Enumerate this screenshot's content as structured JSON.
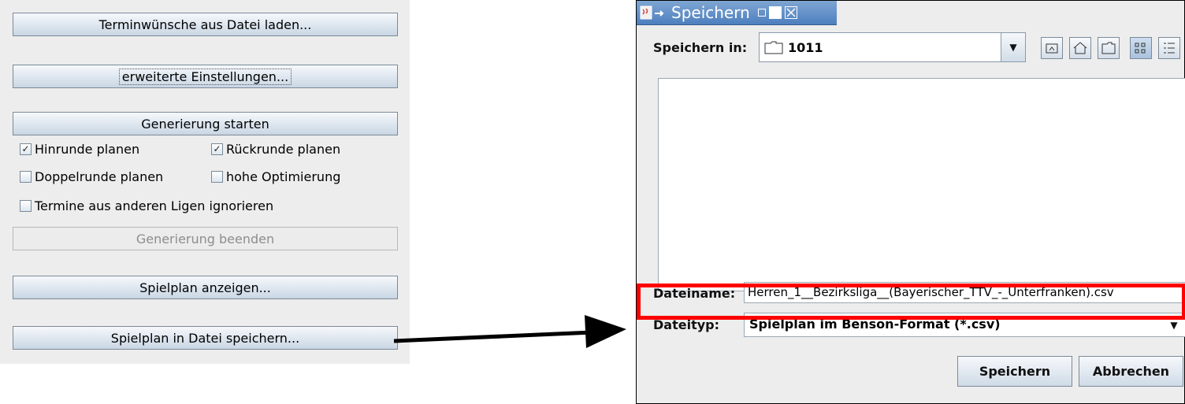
{
  "left": {
    "buttons": {
      "load": "Terminwünsche aus Datei laden...",
      "advanced": "erweiterte Einstellungen...",
      "start": "Generierung starten",
      "stop": "Generierung beenden",
      "show": "Spielplan anzeigen...",
      "save": "Spielplan in Datei speichern..."
    },
    "checkboxes": {
      "hinrunde": {
        "label": "Hinrunde planen",
        "checked": true
      },
      "rueckrunde": {
        "label": "Rückrunde planen",
        "checked": true
      },
      "doppelrunde": {
        "label": "Doppelrunde planen",
        "checked": false
      },
      "optimierung": {
        "label": "hohe Optimierung",
        "checked": false
      },
      "ignorieren": {
        "label": "Termine aus anderen Ligen ignorieren",
        "checked": false
      }
    }
  },
  "dialog": {
    "title": "Speichern",
    "save_in_label": "Speichern in:",
    "folder": "1011",
    "filename_label": "Dateiname:",
    "filename": "Herren_1__Bezirksliga__(Bayerischer_TTV_-_Unterfranken).csv",
    "filetype_label": "Dateityp:",
    "filetype": "Spielplan im Benson-Format (*.csv)",
    "save_button": "Speichern",
    "cancel_button": "Abbrechen"
  },
  "colors": {
    "highlight": "#ff0000",
    "accent": "#4d7fbf"
  },
  "icons": [
    "java-icon",
    "pin-icon",
    "minimize-icon",
    "maximize-icon",
    "close-icon",
    "folder-icon",
    "chevron-down-icon",
    "up-folder-icon",
    "home-icon",
    "new-folder-icon",
    "list-view-icon",
    "details-view-icon"
  ]
}
